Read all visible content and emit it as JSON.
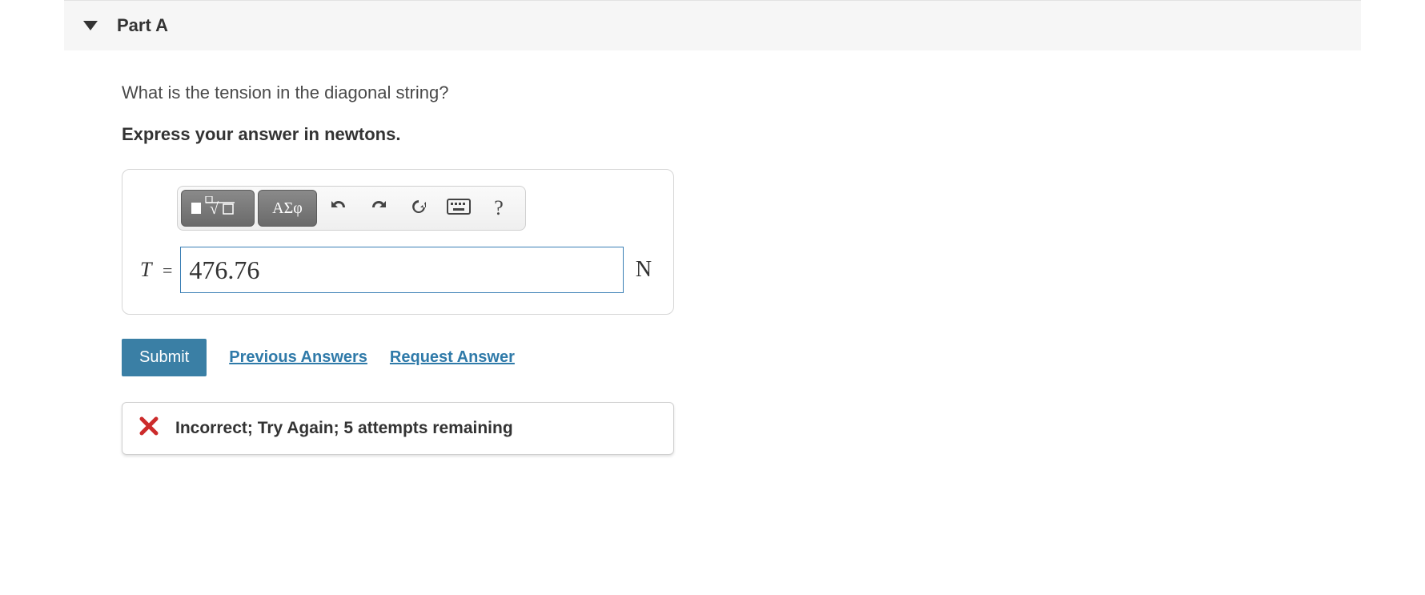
{
  "part": {
    "title": "Part A"
  },
  "question": "What is the tension in the diagonal string?",
  "instruction": "Express your answer in newtons.",
  "toolbar": {
    "math_templates_label": "math-templates",
    "greek_label": "ΑΣφ",
    "undo_label": "undo",
    "redo_label": "redo",
    "reset_label": "reset",
    "keyboard_label": "keyboard",
    "help_label": "?"
  },
  "answer": {
    "variable": "T",
    "equals": "=",
    "value": "476.76",
    "unit": "N"
  },
  "actions": {
    "submit": "Submit",
    "previous": "Previous Answers",
    "request": "Request Answer"
  },
  "feedback": {
    "text": "Incorrect; Try Again; 5 attempts remaining"
  }
}
